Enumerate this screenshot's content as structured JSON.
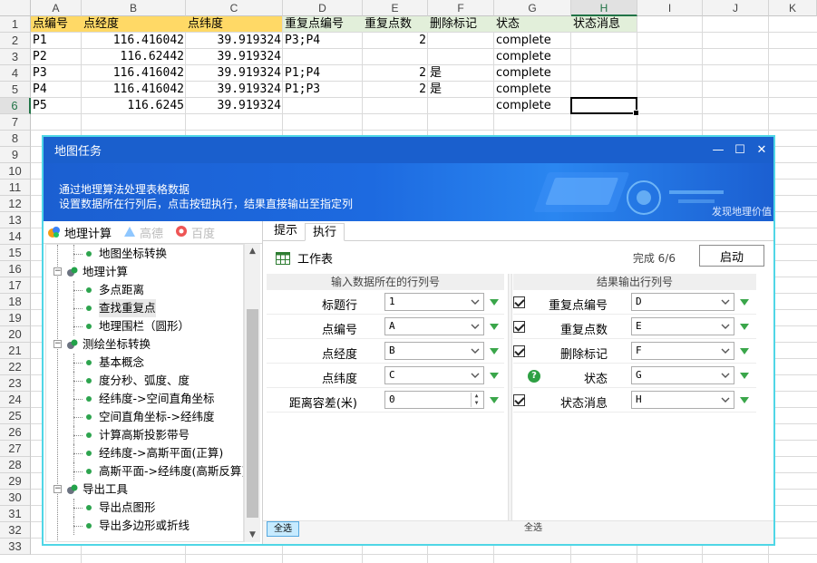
{
  "spreadsheet": {
    "columns": [
      "A",
      "B",
      "C",
      "D",
      "E",
      "F",
      "G",
      "H",
      "I",
      "J",
      "K"
    ],
    "rows": [
      "1",
      "2",
      "3",
      "4",
      "5",
      "6",
      "7",
      "8",
      "9",
      "10",
      "11",
      "12",
      "13",
      "14",
      "15",
      "16",
      "17",
      "18",
      "19",
      "20",
      "21",
      "22",
      "23",
      "24",
      "25",
      "26",
      "27",
      "28",
      "29",
      "30",
      "31",
      "32",
      "33"
    ],
    "active_column": "H",
    "active_row": "6",
    "header_row": [
      "点编号",
      "点经度",
      "点纬度",
      "重复点编号",
      "重复点数",
      "删除标记",
      "状态",
      "状态消息"
    ],
    "data_rows": [
      [
        "P1",
        "116.416042",
        "39.919324",
        "P3;P4",
        "2",
        "",
        "complete",
        ""
      ],
      [
        "P2",
        "116.62442",
        "39.919324",
        "",
        "",
        "",
        "complete",
        ""
      ],
      [
        "P3",
        "116.416042",
        "39.919324",
        "P1;P4",
        "2",
        "是",
        "complete",
        ""
      ],
      [
        "P4",
        "116.416042",
        "39.919324",
        "P1;P3",
        "2",
        "是",
        "complete",
        ""
      ],
      [
        "P5",
        "116.6245",
        "39.919324",
        "",
        "",
        "",
        "complete",
        ""
      ]
    ],
    "colors": {
      "header_input": "#ffd966",
      "header_output": "#e2efda",
      "accent": "#217346"
    }
  },
  "dialog": {
    "title": "地图任务",
    "minimize": "—",
    "maximize": "☐",
    "close": "✕",
    "banner_line1": "通过地理算法处理表格数据",
    "banner_line2": "设置数据所在行列后，点击按钮执行，结果直接输出至指定列",
    "banner_tag": "发现地理价值",
    "left_tabs": [
      {
        "label": "地理计算",
        "icon": "globe-icon"
      },
      {
        "label": "高德",
        "icon": "amap-icon"
      },
      {
        "label": "百度",
        "icon": "baidu-icon"
      }
    ],
    "tree": [
      {
        "label": "地图坐标转换",
        "level": 2
      },
      {
        "label": "地理计算",
        "level": 1
      },
      {
        "label": "多点距离",
        "level": 2
      },
      {
        "label": "查找重复点",
        "level": 2,
        "selected": true
      },
      {
        "label": "地理围栏（圆形）",
        "level": 2
      },
      {
        "label": "测绘坐标转换",
        "level": 1
      },
      {
        "label": "基本概念",
        "level": 2
      },
      {
        "label": "度分秒、弧度、度",
        "level": 2
      },
      {
        "label": "经纬度->空间直角坐标",
        "level": 2
      },
      {
        "label": "空间直角坐标->经纬度",
        "level": 2
      },
      {
        "label": "计算高斯投影带号",
        "level": 2
      },
      {
        "label": "经纬度->高斯平面(正算)",
        "level": 2
      },
      {
        "label": "高斯平面->经纬度(高斯反算)",
        "level": 2
      },
      {
        "label": "导出工具",
        "level": 1
      },
      {
        "label": "导出点图形",
        "level": 2
      },
      {
        "label": "导出多边形或折线",
        "level": 2
      }
    ],
    "right_tabs": [
      "提示",
      "执行"
    ],
    "active_right_tab": "执行",
    "workspace_label": "工作表",
    "progress": "完成 6/6",
    "start_button": "启动",
    "input_section": "输入数据所在的行列号",
    "output_section": "结果输出行列号",
    "inputs": [
      {
        "label": "标题行",
        "value": "1"
      },
      {
        "label": "点编号",
        "value": "A"
      },
      {
        "label": "点经度",
        "value": "B"
      },
      {
        "label": "点纬度",
        "value": "C"
      },
      {
        "label": "距离容差(米)",
        "value": "0"
      }
    ],
    "outputs": [
      {
        "label": "重复点编号",
        "value": "D",
        "checked": true
      },
      {
        "label": "重复点数",
        "value": "E",
        "checked": true
      },
      {
        "label": "删除标记",
        "value": "F",
        "checked": true
      },
      {
        "label": "状态",
        "value": "G",
        "help": true
      },
      {
        "label": "状态消息",
        "value": "H",
        "checked": true
      }
    ],
    "select_all_left": "全选",
    "select_all_right": "全选",
    "colors": {
      "titlebar": "#1a5fcd",
      "border": "#4fd6e6",
      "green": "#2da44e"
    }
  }
}
